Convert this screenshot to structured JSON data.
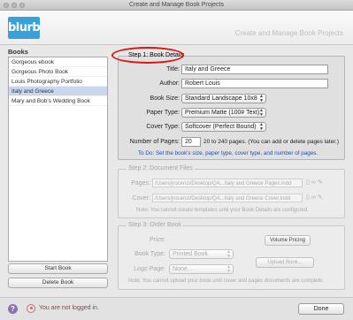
{
  "window": {
    "title": "Create and Manage Book Projects"
  },
  "header": {
    "logo": "blurb",
    "title": "Create and Manage Book Projects"
  },
  "sidebar": {
    "label": "Books",
    "items": [
      {
        "label": "Gorgeous ebook",
        "selected": false
      },
      {
        "label": "Gorgeous Photo Book",
        "selected": false
      },
      {
        "label": "Louis Photography Portfolio",
        "selected": false
      },
      {
        "label": "Italy and Greece",
        "selected": true
      },
      {
        "label": "Mary and Bob's Wedding Book",
        "selected": false
      }
    ],
    "start_button": "Start Book",
    "delete_button": "Delete Book"
  },
  "step1": {
    "title": "Step 1: Book Details",
    "title_label": "Title:",
    "title_value": "Italy and Greece",
    "author_label": "Author:",
    "author_value": "Robert Louis",
    "size_label": "Book Size:",
    "size_value": "Standard Landscape 10x8",
    "paper_label": "Paper Type:",
    "paper_value": "Premium Matte (100# Text)",
    "cover_label": "Cover Type:",
    "cover_value": "Softcover (Perfect Bound)",
    "pages_label": "Number of Pages:",
    "pages_value": "20",
    "pages_range": "20 to 240 pages. (You can add or delete pages later.)",
    "todo": "To Do: Set the book's size, paper type, cover type, and number of pages."
  },
  "step2": {
    "title": "Step 2: Document Files",
    "pages_label": "Pages:",
    "pages_path": "/Users/jrocenzi/Desktop/QA...Italy and Greece Pages.indd",
    "cover_label": "Cover:",
    "cover_path": "/Users/jrocenzi/Desktop/QA...Italy and Greece Cover.indd",
    "note": "Note: You cannot create templates until your Book Details are configured."
  },
  "step3": {
    "title": "Step 3: Order Book",
    "price_label": "Price:",
    "volume_button": "Volume Pricing",
    "book_type_label": "Book Type:",
    "book_type_value": "Printed Book",
    "logo_page_label": "Logo Page:",
    "logo_page_value": "None...",
    "upload_button": "Upload Book...",
    "note": "Note: You cannot upload your book until cover and pages documents are complete."
  },
  "footer": {
    "help": "?",
    "login_status": "You are not logged in.",
    "done_button": "Done"
  },
  "colors": {
    "accent": "#3aa0d8",
    "highlight_oval": "#e21414",
    "todo_text": "#1f4fb4",
    "selection": "#c8d7ee"
  }
}
